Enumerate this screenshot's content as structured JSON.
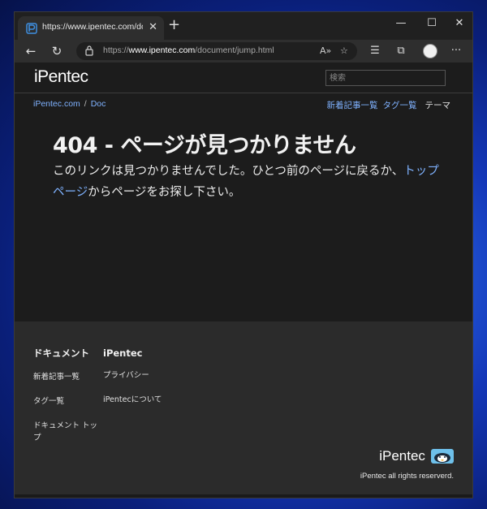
{
  "browser": {
    "tab_title": "https://www.ipentec.com/document",
    "url_prefix": "https://",
    "url_host": "www.ipentec.com",
    "url_path": "/document/jump.html",
    "new_tab_label": "+",
    "tab_close_label": "✕",
    "window": {
      "minimize": "—",
      "maximize": "☐",
      "close": "✕"
    },
    "nav": {
      "back": "←",
      "reload": "↻"
    },
    "toolbar_icons": [
      "read-aloud-icon",
      "favorite-add-icon",
      "favorites-icon",
      "collections-icon",
      "profile-avatar-icon",
      "more-icon"
    ],
    "more_label": "···",
    "read_aloud_label": "A»",
    "fav_add_label": "☆",
    "favorites_label": "☰",
    "collections_label": "⧉"
  },
  "site": {
    "logo": "iPentec",
    "search_placeholder": "検索",
    "breadcrumb": [
      "iPentec.com",
      "Doc"
    ],
    "breadcrumb_sep": "/",
    "nav_new": "新着記事一覧",
    "nav_tags": "タグ一覧",
    "nav_theme": "テーマ"
  },
  "error": {
    "title": "404 - ページが見つかりません",
    "text_before": "このリンクは見つかりませんでした。ひとつ前のページに戻るか、",
    "link": "トップページ",
    "text_after": "からページをお探し下さい。"
  },
  "footer": {
    "col1_head": "ドキュメント",
    "col1_links": [
      "新着記事一覧",
      "タグ一覧",
      "ドキュメント トップ"
    ],
    "col2_head": "iPentec",
    "col2_links": [
      "プライバシー",
      "iPentecについて"
    ],
    "logo": "iPentec",
    "copyright": "iPentec all rights reserverd."
  },
  "colors": {
    "link": "#7fb2ff",
    "page_bg": "#1c1c1c",
    "footer_bg": "#2b2b2b"
  }
}
